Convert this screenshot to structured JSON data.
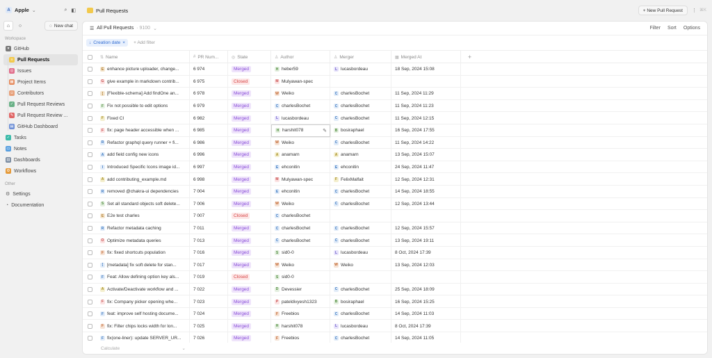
{
  "workspace": {
    "logo_letter": "A",
    "name": "Apple"
  },
  "sidebar": {
    "new_chat_label": "New chat",
    "workspace_section": "Workspace",
    "other_section": "Other",
    "items": [
      {
        "label": "GitHub",
        "icon": "github-icon",
        "sub": false,
        "active": false,
        "color": "#7a7a7a",
        "letter": "▾"
      },
      {
        "label": "Pull Requests",
        "icon": "pull-request-icon",
        "sub": true,
        "active": true,
        "color": "#f2c94c",
        "letter": "≡"
      },
      {
        "label": "Issues",
        "icon": "issue-icon",
        "sub": true,
        "active": false,
        "color": "#e06c8a",
        "letter": "◎"
      },
      {
        "label": "Project Items",
        "icon": "project-icon",
        "sub": true,
        "active": false,
        "color": "#e58a5c",
        "letter": "▦"
      },
      {
        "label": "Contributors",
        "icon": "contributors-icon",
        "sub": true,
        "active": false,
        "color": "#e7a07a",
        "letter": "☺"
      },
      {
        "label": "Pull Request Reviews",
        "icon": "review-icon",
        "sub": true,
        "active": false,
        "color": "#6ab187",
        "letter": "✓"
      },
      {
        "label": "Pull Request Review ...",
        "icon": "review-comment-icon",
        "sub": true,
        "active": false,
        "color": "#e06666",
        "letter": "✎"
      },
      {
        "label": "GitHub Dashboard",
        "icon": "dashboard-icon",
        "sub": true,
        "active": false,
        "color": "#6d8fd6",
        "letter": "▤"
      },
      {
        "label": "Tasks",
        "icon": "tasks-icon",
        "sub": false,
        "active": false,
        "color": "#3dbbaa",
        "letter": "✓"
      },
      {
        "label": "Notes",
        "icon": "notes-icon",
        "sub": false,
        "active": false,
        "color": "#5aa0e0",
        "letter": "▭"
      },
      {
        "label": "Dashboards",
        "icon": "dashboards-icon",
        "sub": false,
        "active": false,
        "color": "#7a8ba0",
        "letter": "▥"
      },
      {
        "label": "Workflows",
        "icon": "workflows-icon",
        "sub": false,
        "active": false,
        "color": "#e59a3a",
        "letter": "⚙"
      }
    ],
    "other_items": [
      {
        "label": "Settings",
        "icon": "settings-icon"
      },
      {
        "label": "Documentation",
        "icon": "documentation-icon"
      }
    ]
  },
  "topbar": {
    "title": "Pull Requests",
    "new_pr_label": "+ New Pull Request",
    "shortcut": "⌘K"
  },
  "view": {
    "name": "All Pull Requests",
    "count": "· 9100",
    "actions": [
      "Filter",
      "Sort",
      "Options"
    ]
  },
  "filters": {
    "chip_label": "Creation date",
    "add_filter_label": "+ Add filter"
  },
  "columns": {
    "name": "Name",
    "num": "PR Num...",
    "state": "State",
    "author": "Author",
    "merger": "Merger",
    "merged_at": "Merged At"
  },
  "rows": [
    {
      "letter": "E",
      "ic_bg": "#f4e6cf",
      "ic_fg": "#b07a2a",
      "name": "enhance picture uploader, change...",
      "num": "6 974",
      "state": "Merged",
      "author": "heber59",
      "author_letter": "H",
      "author_bg": "#e4efe0",
      "author_fg": "#4c8b3a",
      "merger": "lucasbordeau",
      "merger_letter": "L",
      "merger_bg": "#e6e2fa",
      "merger_fg": "#6a55c8",
      "merged_at": "18 Sep, 2024 15:08"
    },
    {
      "letter": "G",
      "ic_bg": "#fbe3e3",
      "ic_fg": "#c84a4a",
      "name": "give example in markdown contrib...",
      "num": "6 975",
      "state": "Closed",
      "author": "Mulyawan-spec",
      "author_letter": "M",
      "author_bg": "#fbe3e3",
      "author_fg": "#c84a4a",
      "merger": "",
      "merger_letter": "",
      "merger_bg": "",
      "merger_fg": "",
      "merged_at": ""
    },
    {
      "letter": "[",
      "ic_bg": "#f4e6cf",
      "ic_fg": "#b07a2a",
      "name": "[Flexible-schema] Add findOne an...",
      "num": "6 978",
      "state": "Merged",
      "author": "Weiko",
      "author_letter": "W",
      "author_bg": "#f6e3d6",
      "author_fg": "#c0622a",
      "merger": "charlesBochet",
      "merger_letter": "C",
      "merger_bg": "#e2ecf8",
      "merger_fg": "#3a78c2",
      "merged_at": "11 Sep, 2024 11:29"
    },
    {
      "letter": "F",
      "ic_bg": "#e6f2e4",
      "ic_fg": "#4c8b3a",
      "name": "Fix not possible to edit options",
      "num": "6 979",
      "state": "Merged",
      "author": "charlesBochet",
      "author_letter": "C",
      "author_bg": "#e2ecf8",
      "author_fg": "#3a78c2",
      "merger": "charlesBochet",
      "merger_letter": "C",
      "merger_bg": "#e2ecf8",
      "merger_fg": "#3a78c2",
      "merged_at": "11 Sep, 2024 11:23"
    },
    {
      "letter": "F",
      "ic_bg": "#f4efcf",
      "ic_fg": "#a58a1a",
      "name": "Fixed CI",
      "num": "6 982",
      "state": "Merged",
      "author": "lucasbordeau",
      "author_letter": "L",
      "author_bg": "#e6e2fa",
      "author_fg": "#6a55c8",
      "merger": "charlesBochet",
      "merger_letter": "C",
      "merger_bg": "#e2ecf8",
      "merger_fg": "#3a78c2",
      "merged_at": "11 Sep, 2024 12:15"
    },
    {
      "letter": "F",
      "ic_bg": "#fbe3e3",
      "ic_fg": "#c84a4a",
      "name": "fix: page header accessible when ...",
      "num": "6 985",
      "state": "Merged",
      "author": "harshit078",
      "author_letter": "H",
      "author_bg": "#e4efe0",
      "author_fg": "#4c8b3a",
      "merger": "bosiraphael",
      "merger_letter": "B",
      "merger_bg": "#e4efe0",
      "merger_fg": "#4c8b3a",
      "merged_at": "16 Sep, 2024 17:55",
      "selected": true
    },
    {
      "letter": "R",
      "ic_bg": "#e2ecf8",
      "ic_fg": "#3a78c2",
      "name": "Refactor graphql query runner + fi...",
      "num": "6 986",
      "state": "Merged",
      "author": "Weiko",
      "author_letter": "W",
      "author_bg": "#f6e3d6",
      "author_fg": "#c0622a",
      "merger": "charlesBochet",
      "merger_letter": "C",
      "merger_bg": "#e2ecf8",
      "merger_fg": "#3a78c2",
      "merged_at": "11 Sep, 2024 14:22"
    },
    {
      "letter": "A",
      "ic_bg": "#e2ecf8",
      "ic_fg": "#3a78c2",
      "name": "add field config new icons",
      "num": "6 996",
      "state": "Merged",
      "author": "anamarn",
      "author_letter": "A",
      "author_bg": "#f4efcf",
      "author_fg": "#a58a1a",
      "merger": "anamarn",
      "merger_letter": "A",
      "merger_bg": "#f4efcf",
      "merger_fg": "#a58a1a",
      "merged_at": "13 Sep, 2024 15:07"
    },
    {
      "letter": "I",
      "ic_bg": "#e2ecf8",
      "ic_fg": "#3a78c2",
      "name": "Introduced Specific Icons image id...",
      "num": "6 997",
      "state": "Merged",
      "author": "ehconitin",
      "author_letter": "E",
      "author_bg": "#e2ecf8",
      "author_fg": "#3a78c2",
      "merger": "ehconitin",
      "merger_letter": "E",
      "merger_bg": "#e2ecf8",
      "merger_fg": "#3a78c2",
      "merged_at": "24 Sep, 2024 11:47"
    },
    {
      "letter": "A",
      "ic_bg": "#f4efcf",
      "ic_fg": "#a58a1a",
      "name": "add contributing_example.md",
      "num": "6 998",
      "state": "Merged",
      "author": "Mulyawan-spec",
      "author_letter": "M",
      "author_bg": "#fbe3e3",
      "author_fg": "#c84a4a",
      "merger": "FelixMalfait",
      "merger_letter": "F",
      "merger_bg": "#f4efcf",
      "merger_fg": "#a58a1a",
      "merged_at": "12 Sep, 2024 12:31"
    },
    {
      "letter": "R",
      "ic_bg": "#e2ecf8",
      "ic_fg": "#3a78c2",
      "name": "removed @chakra-ui dependencies",
      "num": "7 004",
      "state": "Merged",
      "author": "ehconitin",
      "author_letter": "E",
      "author_bg": "#e2ecf8",
      "author_fg": "#3a78c2",
      "merger": "charlesBochet",
      "merger_letter": "C",
      "merger_bg": "#e2ecf8",
      "merger_fg": "#3a78c2",
      "merged_at": "14 Sep, 2024 18:55"
    },
    {
      "letter": "S",
      "ic_bg": "#e4efe0",
      "ic_fg": "#4c8b3a",
      "name": "Set all standard objects soft delete...",
      "num": "7 006",
      "state": "Merged",
      "author": "Weiko",
      "author_letter": "W",
      "author_bg": "#f6e3d6",
      "author_fg": "#c0622a",
      "merger": "charlesBochet",
      "merger_letter": "C",
      "merger_bg": "#e2ecf8",
      "merger_fg": "#3a78c2",
      "merged_at": "12 Sep, 2024 13:44"
    },
    {
      "letter": "E",
      "ic_bg": "#f4e6cf",
      "ic_fg": "#b07a2a",
      "name": "E2e test charles",
      "num": "7 007",
      "state": "Closed",
      "author": "charlesBochet",
      "author_letter": "C",
      "author_bg": "#e2ecf8",
      "author_fg": "#3a78c2",
      "merger": "",
      "merger_letter": "",
      "merger_bg": "",
      "merger_fg": "",
      "merged_at": ""
    },
    {
      "letter": "R",
      "ic_bg": "#e2ecf8",
      "ic_fg": "#3a78c2",
      "name": "Refactor metadata caching",
      "num": "7 011",
      "state": "Merged",
      "author": "charlesBochet",
      "author_letter": "C",
      "author_bg": "#e2ecf8",
      "author_fg": "#3a78c2",
      "merger": "charlesBochet",
      "merger_letter": "C",
      "merger_bg": "#e2ecf8",
      "merger_fg": "#3a78c2",
      "merged_at": "12 Sep, 2024 15:57"
    },
    {
      "letter": "O",
      "ic_bg": "#fbe3e3",
      "ic_fg": "#c84a4a",
      "name": "Optimize metadata queries",
      "num": "7 013",
      "state": "Merged",
      "author": "charlesBochet",
      "author_letter": "C",
      "author_bg": "#e2ecf8",
      "author_fg": "#3a78c2",
      "merger": "charlesBochet",
      "merger_letter": "C",
      "merger_bg": "#e2ecf8",
      "merger_fg": "#3a78c2",
      "merged_at": "13 Sep, 2024 19:11"
    },
    {
      "letter": "F",
      "ic_bg": "#f6e3d6",
      "ic_fg": "#c0622a",
      "name": "fix: fixed shortcuts population",
      "num": "7 016",
      "state": "Merged",
      "author": "sid0-0",
      "author_letter": "S",
      "author_bg": "#e4efe0",
      "author_fg": "#4c8b3a",
      "merger": "lucasbordeau",
      "merger_letter": "L",
      "merger_bg": "#e6e2fa",
      "merger_fg": "#6a55c8",
      "merged_at": "8 Oct, 2024 17:39"
    },
    {
      "letter": "[",
      "ic_bg": "#e2ecf8",
      "ic_fg": "#3a78c2",
      "name": "[metadata] fix soft delete for stan...",
      "num": "7 017",
      "state": "Merged",
      "author": "Weiko",
      "author_letter": "W",
      "author_bg": "#f6e3d6",
      "author_fg": "#c0622a",
      "merger": "Weiko",
      "merger_letter": "W",
      "merger_bg": "#f6e3d6",
      "merger_fg": "#c0622a",
      "merged_at": "13 Sep, 2024 12:03"
    },
    {
      "letter": "F",
      "ic_bg": "#e2ecf8",
      "ic_fg": "#3a78c2",
      "name": "Feat: Allow defining option key als...",
      "num": "7 019",
      "state": "Closed",
      "author": "sid0-0",
      "author_letter": "S",
      "author_bg": "#e4efe0",
      "author_fg": "#4c8b3a",
      "merger": "",
      "merger_letter": "",
      "merger_bg": "",
      "merger_fg": "",
      "merged_at": ""
    },
    {
      "letter": "A",
      "ic_bg": "#f4efcf",
      "ic_fg": "#a58a1a",
      "name": "Activate/Deactivate workflow and ...",
      "num": "7 022",
      "state": "Merged",
      "author": "Devessier",
      "author_letter": "D",
      "author_bg": "#e4efe0",
      "author_fg": "#4c8b3a",
      "merger": "charlesBochet",
      "merger_letter": "C",
      "merger_bg": "#e2ecf8",
      "merger_fg": "#3a78c2",
      "merged_at": "25 Sep, 2024 18:09"
    },
    {
      "letter": "F",
      "ic_bg": "#fbe3e3",
      "ic_fg": "#c84a4a",
      "name": "fix: Company picker opening whe...",
      "num": "7 023",
      "state": "Merged",
      "author": "pateldivyesh1323",
      "author_letter": "P",
      "author_bg": "#fbe3e3",
      "author_fg": "#c84a4a",
      "merger": "bosiraphael",
      "merger_letter": "B",
      "merger_bg": "#e4efe0",
      "merger_fg": "#4c8b3a",
      "merged_at": "16 Sep, 2024 15:25"
    },
    {
      "letter": "F",
      "ic_bg": "#e2ecf8",
      "ic_fg": "#3a78c2",
      "name": "feat: improve self hosting docume...",
      "num": "7 024",
      "state": "Merged",
      "author": "Freebios",
      "author_letter": "F",
      "author_bg": "#f6e3d6",
      "author_fg": "#c0622a",
      "merger": "charlesBochet",
      "merger_letter": "C",
      "merger_bg": "#e2ecf8",
      "merger_fg": "#3a78c2",
      "merged_at": "14 Sep, 2024 11:03"
    },
    {
      "letter": "F",
      "ic_bg": "#f6e3d6",
      "ic_fg": "#c0622a",
      "name": "fix: Filter chips locks width for lon...",
      "num": "7 025",
      "state": "Merged",
      "author": "harshit078",
      "author_letter": "H",
      "author_bg": "#e4efe0",
      "author_fg": "#4c8b3a",
      "merger": "lucasbordeau",
      "merger_letter": "L",
      "merger_bg": "#e6e2fa",
      "merger_fg": "#6a55c8",
      "merged_at": "8 Oct, 2024 17:39"
    },
    {
      "letter": "F",
      "ic_bg": "#e2ecf8",
      "ic_fg": "#3a78c2",
      "name": "fix(one-liner): update SERVER_UR...",
      "num": "7 026",
      "state": "Merged",
      "author": "Freebios",
      "author_letter": "F",
      "author_bg": "#f6e3d6",
      "author_fg": "#c0622a",
      "merger": "charlesBochet",
      "merger_letter": "C",
      "merger_bg": "#e2ecf8",
      "merger_fg": "#3a78c2",
      "merged_at": "14 Sep, 2024 11:05"
    }
  ],
  "footer": {
    "calculate_label": "Calculate"
  }
}
